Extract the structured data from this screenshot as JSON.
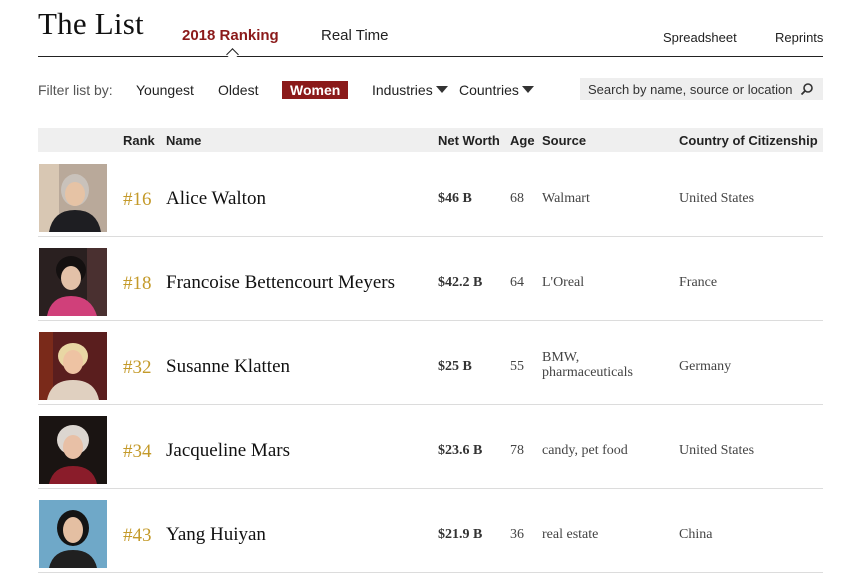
{
  "header": {
    "brand": "The List",
    "tabs": [
      {
        "label": "2018 Ranking",
        "active": true
      },
      {
        "label": "Real Time",
        "active": false
      }
    ],
    "links": {
      "spreadsheet": "Spreadsheet",
      "reprints": "Reprints"
    }
  },
  "filter": {
    "label": "Filter list by:",
    "youngest": "Youngest",
    "oldest": "Oldest",
    "women": "Women",
    "industries": "Industries",
    "countries": "Countries",
    "search_placeholder": "Search by name, source or location"
  },
  "table": {
    "columns": {
      "rank": "Rank",
      "name": "Name",
      "net_worth": "Net Worth",
      "age": "Age",
      "source": "Source",
      "country": "Country of Citizenship"
    },
    "rows": [
      {
        "rank": "#16",
        "name": "Alice Walton",
        "net_worth": "$46 B",
        "age": "68",
        "source": "Walmart",
        "country": "United States"
      },
      {
        "rank": "#18",
        "name": "Francoise Bettencourt Meyers",
        "net_worth": "$42.2 B",
        "age": "64",
        "source": "L'Oreal",
        "country": "France"
      },
      {
        "rank": "#32",
        "name": "Susanne Klatten",
        "net_worth": "$25 B",
        "age": "55",
        "source": "BMW, pharmaceuticals",
        "country": "Germany"
      },
      {
        "rank": "#34",
        "name": "Jacqueline Mars",
        "net_worth": "$23.6 B",
        "age": "78",
        "source": "candy, pet food",
        "country": "United States"
      },
      {
        "rank": "#43",
        "name": "Yang Huiyan",
        "net_worth": "$21.9 B",
        "age": "36",
        "source": "real estate",
        "country": "China"
      }
    ]
  },
  "colors": {
    "accent": "#8b1a1a",
    "rank_gold": "#c49a2a",
    "header_bg": "#efefef",
    "search_bg": "#eeeeee"
  }
}
